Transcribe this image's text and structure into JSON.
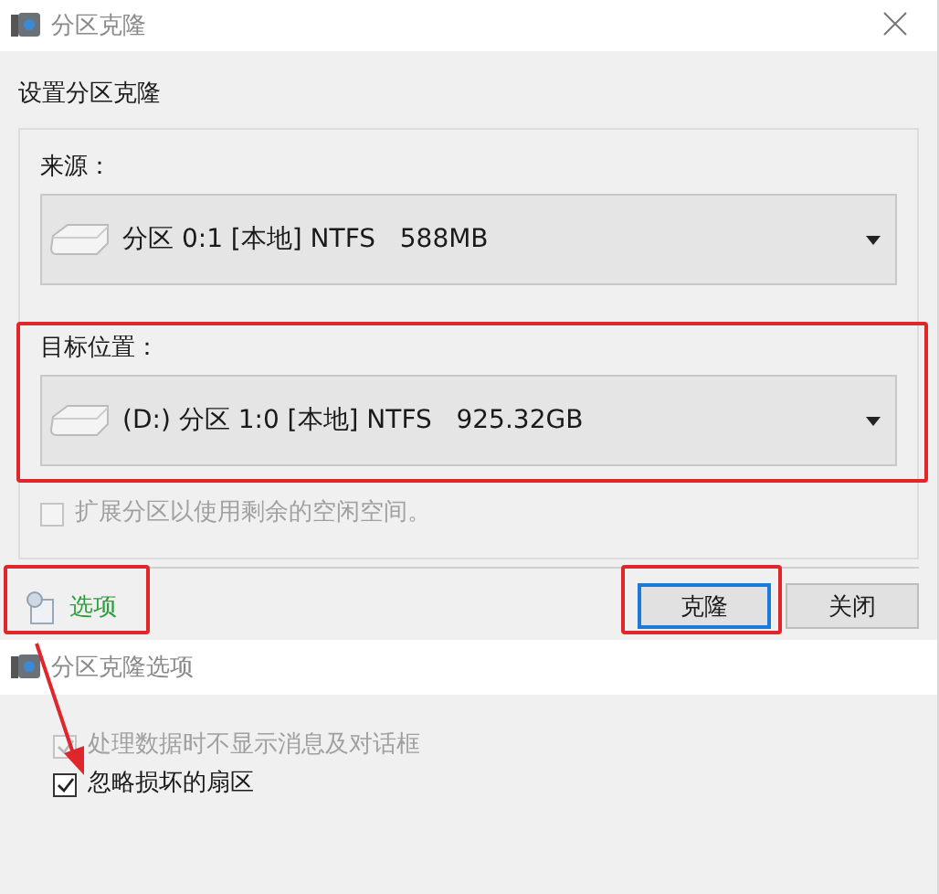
{
  "clone_dialog": {
    "title": "分区克隆",
    "heading": "设置分区克隆",
    "source": {
      "label": "来源：",
      "value": "分区 0:1 [本地] NTFS   588MB"
    },
    "target": {
      "label": "目标位置：",
      "value": "(D:) 分区 1:0 [本地] NTFS   925.32GB"
    },
    "expand_option": {
      "label": "扩展分区以使用剩余的空闲空间。",
      "checked": false,
      "disabled": true
    },
    "options_link": "选项",
    "buttons": [
      {
        "label": "克隆",
        "selected": true
      },
      {
        "label": "关闭",
        "selected": false
      }
    ]
  },
  "options_dialog": {
    "title": "分区克隆选项",
    "options": [
      {
        "label": "处理数据时不显示消息及对话框",
        "checked": true,
        "disabled": true
      },
      {
        "label": "忽略损坏的扇区",
        "checked": true,
        "disabled": false
      }
    ]
  }
}
